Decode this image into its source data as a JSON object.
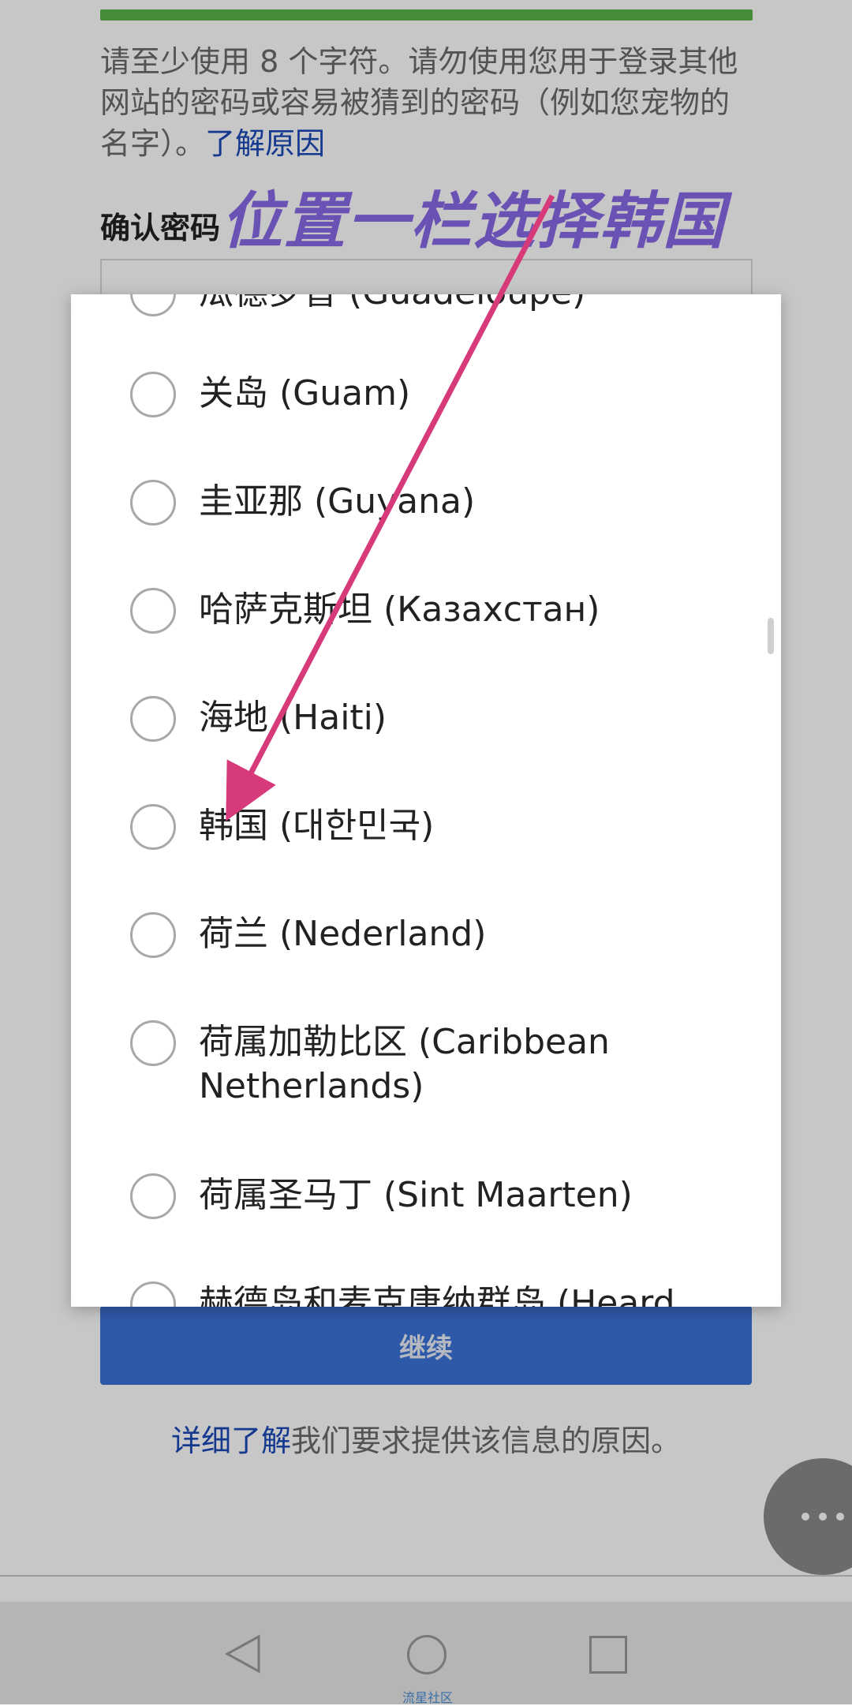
{
  "form": {
    "password_hint": "请至少使用 8 个字符。请勿使用您用于登录其他网站的密码或容易被猜到的密码（例如您宠物的名字）。",
    "password_hint_link": "了解原因",
    "confirm_label": "确认密码",
    "continue_label": "继续",
    "learn_more_link": "详细了解",
    "learn_more_text": "我们要求提供该信息的原因。"
  },
  "annotation": {
    "text": "位置一栏选择韩国",
    "arrow_color": "#d63a7a"
  },
  "dialog": {
    "options": [
      {
        "label": "瓜德罗普 (Guadeloupe)"
      },
      {
        "label": "关岛 (Guam)"
      },
      {
        "label": "圭亚那 (Guyana)"
      },
      {
        "label": "哈萨克斯坦 (Казахстан)"
      },
      {
        "label": "海地 (Haiti)"
      },
      {
        "label": "韩国 (대한민국)"
      },
      {
        "label": "荷兰 (Nederland)"
      },
      {
        "label": "荷属加勒比区 (Caribbean Netherlands)"
      },
      {
        "label": "荷属圣马丁 (Sint Maarten)"
      },
      {
        "label": "赫德岛和麦克唐纳群岛 (Heard"
      }
    ]
  },
  "watermark": "流星社区",
  "colors": {
    "link": "#1a49b8",
    "button": "#3b72d8",
    "strength": "#5ab44a",
    "annotation": "#6a52b5"
  }
}
